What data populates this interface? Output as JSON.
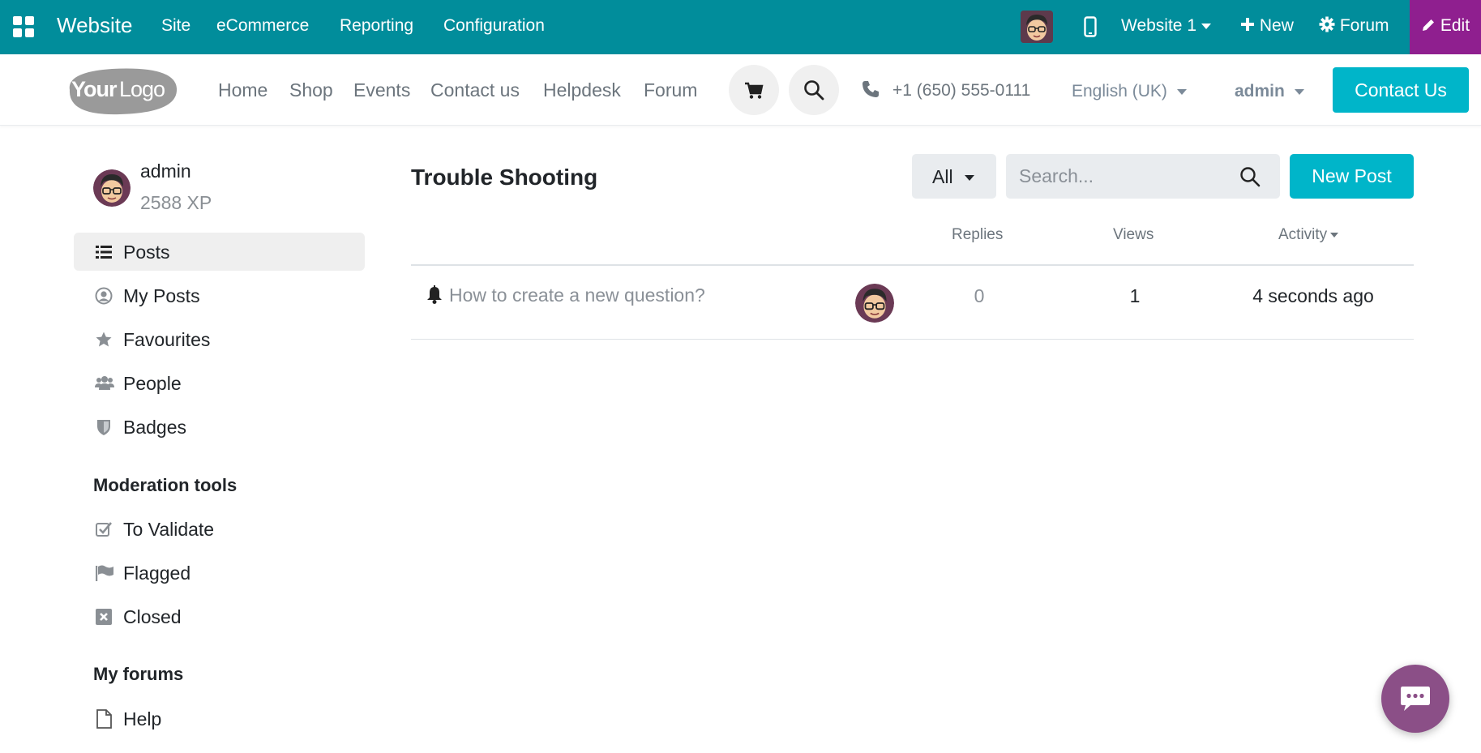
{
  "topbar": {
    "brand": "Website",
    "menu": [
      "Site",
      "eCommerce",
      "Reporting",
      "Configuration"
    ],
    "website_selector": "Website 1",
    "new_label": "New",
    "forum_label": "Forum",
    "edit_label": "Edit",
    "bg_color": "#018d9b",
    "edit_color": "#8f1f8f"
  },
  "header": {
    "logo_text_bold": "Your",
    "logo_text": "Logo",
    "nav": [
      "Home",
      "Shop",
      "Events",
      "Contact us",
      "Helpdesk",
      "Forum"
    ],
    "phone": "+1 (650) 555-0111",
    "language": "English (UK)",
    "user": "admin",
    "contact_button": "Contact Us",
    "accent_color": "#00b5c9"
  },
  "sidebar": {
    "profile": {
      "name": "admin",
      "xp": "2588 XP"
    },
    "items": [
      {
        "label": "Posts",
        "icon": "list-icon",
        "active": true
      },
      {
        "label": "My Posts",
        "icon": "user-circle-icon",
        "active": false
      },
      {
        "label": "Favourites",
        "icon": "star-icon",
        "active": false
      },
      {
        "label": "People",
        "icon": "users-icon",
        "active": false
      },
      {
        "label": "Badges",
        "icon": "shield-icon",
        "active": false
      }
    ],
    "moderation_heading": "Moderation tools",
    "moderation": [
      {
        "label": "To Validate",
        "icon": "check-square-icon"
      },
      {
        "label": "Flagged",
        "icon": "flag-icon"
      },
      {
        "label": "Closed",
        "icon": "close-square-icon"
      }
    ],
    "forums_heading": "My forums",
    "forums": [
      {
        "label": "Help",
        "icon": "file-icon"
      }
    ]
  },
  "main": {
    "title": "Trouble Shooting",
    "filter": "All",
    "search_placeholder": "Search...",
    "new_post": "New Post",
    "columns": {
      "replies": "Replies",
      "views": "Views",
      "activity": "Activity"
    },
    "posts": [
      {
        "title": "How to create a new question?",
        "replies": "0",
        "views": "1",
        "activity": "4 seconds ago"
      }
    ]
  }
}
